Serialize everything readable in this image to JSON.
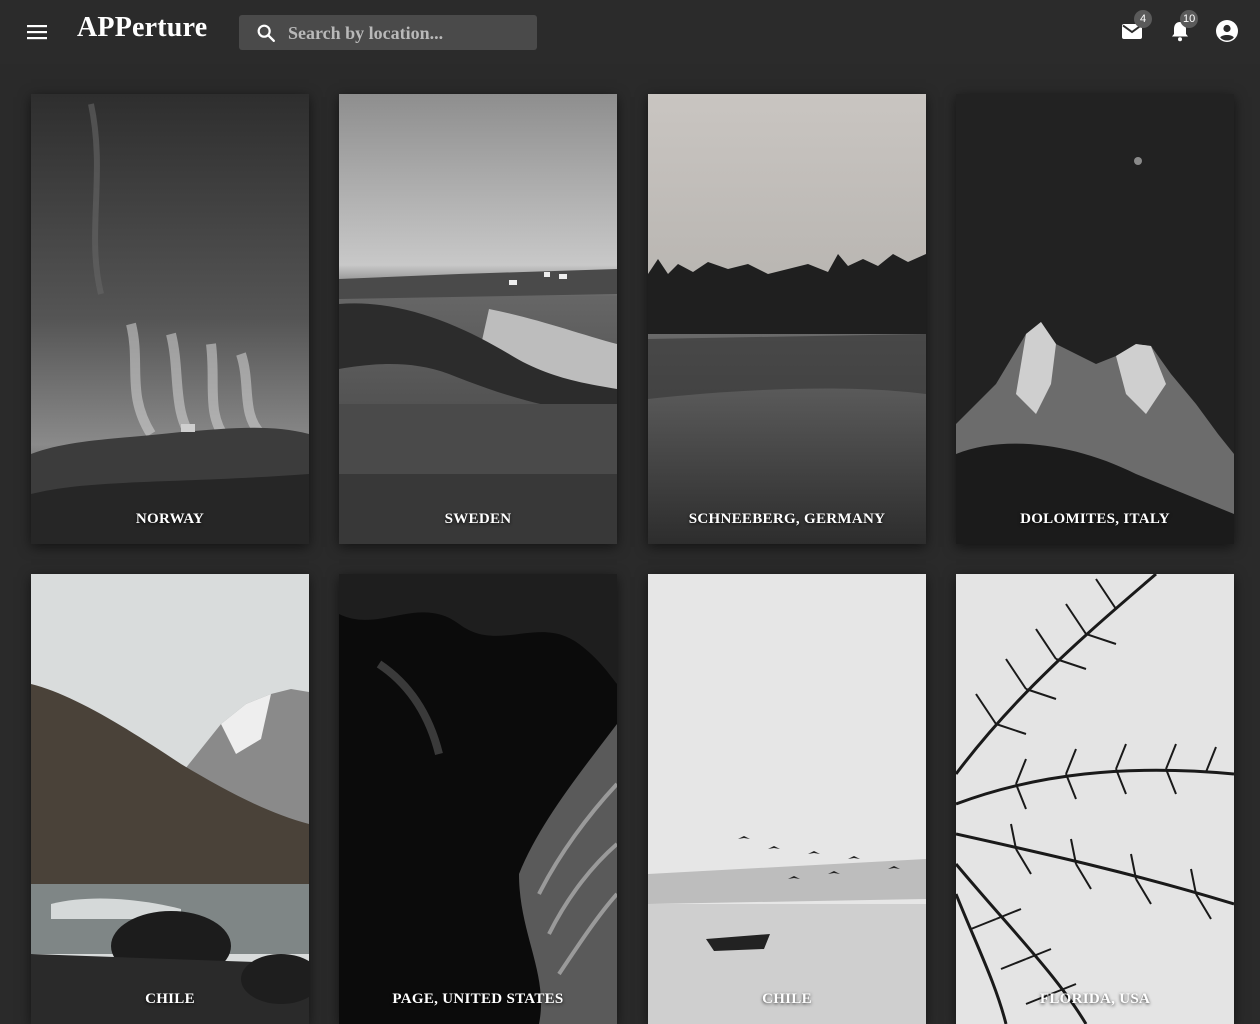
{
  "app": {
    "title": "APPerture"
  },
  "search": {
    "placeholder": "Search by location..."
  },
  "header_icons": {
    "menu": "menu-icon",
    "search": "search-icon",
    "mail": "mail-icon",
    "notifications": "bell-icon",
    "account": "account-circle-icon"
  },
  "badges": {
    "mail": "4",
    "notifications": "10"
  },
  "photos": [
    {
      "location": "NORWAY"
    },
    {
      "location": "SWEDEN"
    },
    {
      "location": "SCHNEEBERG, GERMANY"
    },
    {
      "location": "DOLOMITES, ITALY"
    },
    {
      "location": "CHILE"
    },
    {
      "location": "PAGE, UNITED STATES"
    },
    {
      "location": "CHILE"
    },
    {
      "location": "FLORIDA, USA"
    }
  ],
  "colors": {
    "background": "#2a2a2a",
    "appbar": "#2b2b2b",
    "search_bg": "#4a4a4a",
    "badge_bg": "#5a5a5a"
  }
}
